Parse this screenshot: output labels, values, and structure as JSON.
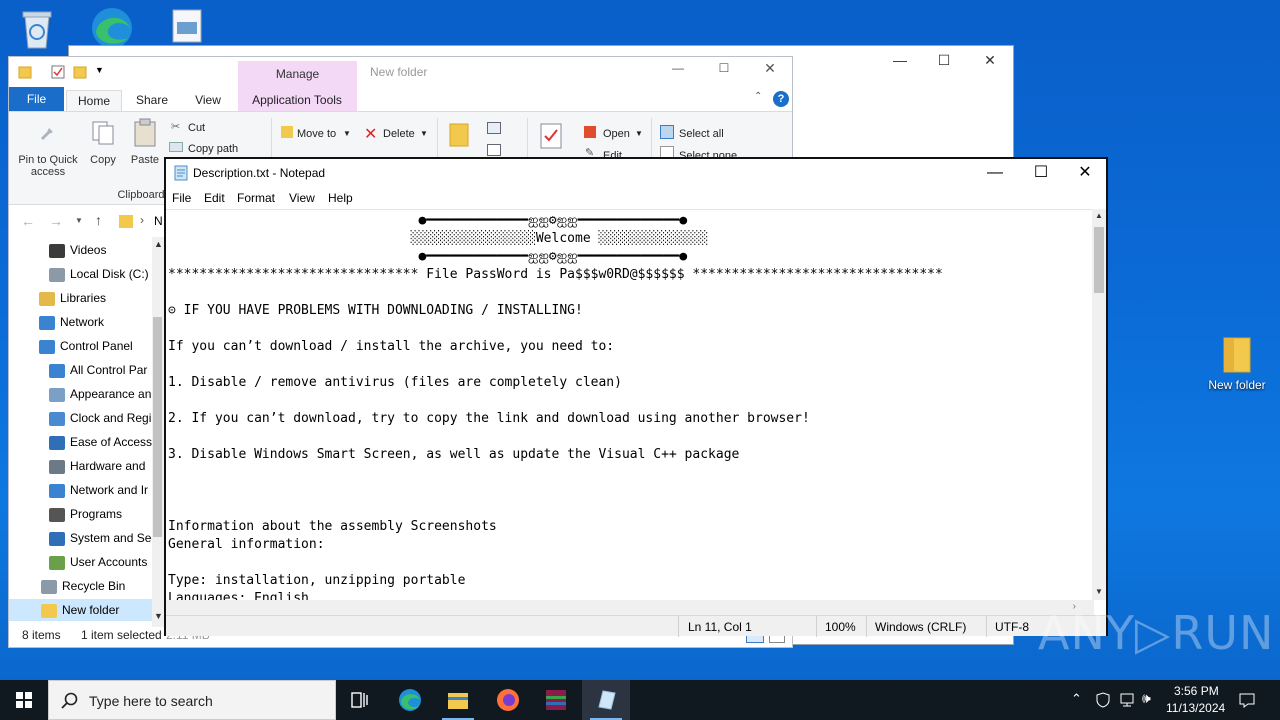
{
  "desktop": {
    "icons": [
      {
        "name": "recycle-bin-icon",
        "label": ""
      },
      {
        "name": "edge-icon",
        "label": ""
      },
      {
        "name": "file-icon",
        "label": ""
      },
      {
        "name": "folder-icon",
        "label": "New folder"
      }
    ]
  },
  "explorer": {
    "title": "New folder",
    "context_tab": "Manage",
    "tabs": {
      "file": "File",
      "home": "Home",
      "share": "Share",
      "view": "View",
      "app_tools": "Application Tools"
    },
    "ribbon": {
      "pin": "Pin to Quick access",
      "copy": "Copy",
      "paste": "Paste",
      "cut": "Cut",
      "copy_path": "Copy path",
      "clipboard": "Clipboard",
      "move_to": "Move to",
      "delete": "Delete",
      "open": "Open",
      "edit": "Edit",
      "select_all": "Select all",
      "select_none": "Select none"
    },
    "breadcrumb_partial": "N",
    "tree": [
      {
        "label": "Videos",
        "color": "#3b3b3b"
      },
      {
        "label": "Local Disk (C:)",
        "color": "#8c9aa8"
      },
      {
        "label": "Libraries",
        "color": "#e5b84a"
      },
      {
        "label": "Network",
        "color": "#3a83d0"
      },
      {
        "label": "Control Panel",
        "color": "#3a83d0"
      },
      {
        "label": "All Control Par",
        "color": "#3a83d0"
      },
      {
        "label": "Appearance an",
        "color": "#7aa0c8"
      },
      {
        "label": "Clock and Regi",
        "color": "#4a8ad0"
      },
      {
        "label": "Ease of Access",
        "color": "#2f6fb8"
      },
      {
        "label": "Hardware and",
        "color": "#6c7a88"
      },
      {
        "label": "Network and Ir",
        "color": "#3a83d0"
      },
      {
        "label": "Programs",
        "color": "#555"
      },
      {
        "label": "System and Sec",
        "color": "#2f6fb8"
      },
      {
        "label": "User Accounts",
        "color": "#6aa04a"
      },
      {
        "label": "Recycle Bin",
        "color": "#8c9aa8"
      },
      {
        "label": "New folder",
        "color": "#f2c94c"
      }
    ],
    "status": {
      "items": "8 items",
      "selected": "1 item selected",
      "size": "2.11 MB"
    }
  },
  "notepad": {
    "title": "Description.txt - Notepad",
    "menu": [
      "File",
      "Edit",
      "Format",
      "View",
      "Help"
    ],
    "lines": [
      "                                ●━━━━━━━━━━━━━ஐஐ⚙ஐஐ━━━━━━━━━━━━━●",
      "                               ░░░░░░░░░░░░░░░░Welcome ░░░░░░░░░░░░░░",
      "                                ●━━━━━━━━━━━━━ஐஐ⚙ஐஐ━━━━━━━━━━━━━●",
      "******************************** File PassWord is Pa$$$w0RD@$$$$$$ ********************************",
      "",
      "⊝ IF YOU HAVE PROBLEMS WITH DOWNLOADING / INSTALLING!",
      "",
      "If you can’t download / install the archive, you need to:",
      "",
      "1. Disable / remove antivirus (files are completely clean)",
      "",
      "2. If you can’t download, try to copy the link and download using another browser!",
      "",
      "3. Disable Windows Smart Screen, as well as update the Visual C++ package",
      "",
      "",
      "",
      "Information about the assembly Screenshots",
      "General information:",
      "",
      "Type: installation, unzipping portable",
      "Languages: English"
    ],
    "status": {
      "pos": "Ln 11, Col 1",
      "zoom": "100%",
      "eol": "Windows (CRLF)",
      "enc": "UTF-8"
    }
  },
  "taskbar": {
    "search_placeholder": "Type here to search",
    "time": "3:56 PM",
    "date": "11/13/2024"
  },
  "watermark": "ANY▷RUN"
}
